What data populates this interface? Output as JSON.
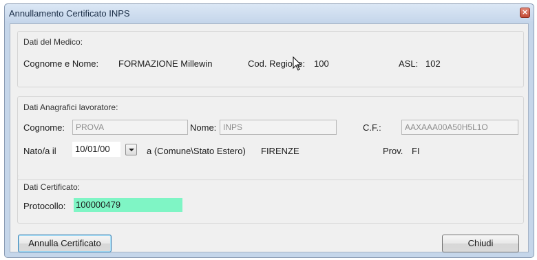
{
  "window": {
    "title": "Annullamento Certificato INPS",
    "close_glyph": "×"
  },
  "medico": {
    "group_title": "Dati del Medico:",
    "nome_label": "Cognome e Nome:",
    "nome_value": "FORMAZIONE Millewin",
    "regione_label": "Cod. Regione:",
    "regione_value": "100",
    "asl_label": "ASL:",
    "asl_value": "102"
  },
  "lavoratore": {
    "group_title": "Dati Anagrafici lavoratore:",
    "cognome_label": "Cognome:",
    "cognome_value": "PROVA",
    "nome_label": "Nome:",
    "nome_value": "INPS",
    "cf_label": "C.F.:",
    "cf_value": "AAXAAA00A50H5L1O",
    "nato_label": "Nato/a il",
    "nato_value": "10/01/00",
    "comune_label": "a (Comune\\Stato Estero)",
    "comune_value": "FIRENZE",
    "prov_label": "Prov.",
    "prov_value": "FI"
  },
  "certificato": {
    "group_title": "Dati Certificato:",
    "protocollo_label": "Protocollo:",
    "protocollo_value": "100000479"
  },
  "buttons": {
    "annulla": "Annulla Certificato",
    "chiudi": "Chiudi"
  },
  "colors": {
    "highlight_field": "#7ff5c5",
    "window_frame": "#c5d6ea",
    "close_button": "#c24a35"
  },
  "icons": [
    "close-icon",
    "dropdown-arrow-icon",
    "mouse-cursor-icon"
  ]
}
